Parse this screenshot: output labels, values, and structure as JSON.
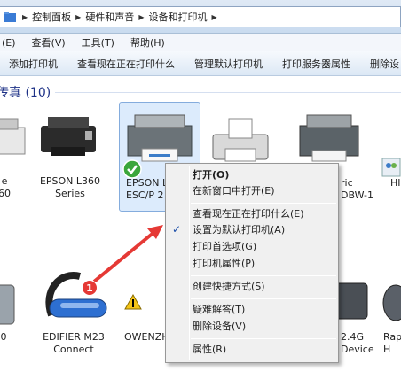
{
  "address": {
    "crumbs": [
      "控制面板",
      "硬件和声音",
      "设备和打印机"
    ]
  },
  "menu": {
    "items": [
      "(E)",
      "查看(V)",
      "工具(T)",
      "帮助(H)"
    ]
  },
  "commands": {
    "items": [
      "添加打印机",
      "查看现在正在打印什么",
      "管理默认打印机",
      "打印服务器属性",
      "删除设"
    ]
  },
  "group": {
    "title": "传真 (10)"
  },
  "devices": [
    {
      "name": [
        "e",
        "60"
      ]
    },
    {
      "name": [
        "EPSON L360",
        "Series"
      ]
    },
    {
      "name": [
        "EPSON L",
        "ESC/P 2 V"
      ]
    },
    {
      "name": [
        "",
        ""
      ]
    },
    {
      "name": [
        "ric",
        "DBW-1"
      ]
    },
    {
      "name": [
        "HI",
        ""
      ]
    },
    {
      "name": [
        "0",
        ""
      ]
    },
    {
      "name": [
        "EDIFIER M23",
        "Connect"
      ]
    },
    {
      "name": [
        "OWENZH",
        ""
      ]
    },
    {
      "name": [
        "2.4G",
        "Device"
      ]
    },
    {
      "name": [
        "Rap",
        "H"
      ]
    }
  ],
  "badge": "1",
  "context_menu": {
    "open": "打开(O)",
    "open_new": "在新窗口中打开(E)",
    "see_printing": "查看现在正在打印什么(E)",
    "set_default": "设置为默认打印机(A)",
    "prefs": "打印首选项(G)",
    "printer_props": "打印机属性(P)",
    "shortcut": "创建快捷方式(S)",
    "troubleshoot": "疑难解答(T)",
    "remove": "删除设备(V)",
    "properties": "属性(R)"
  },
  "colors": {
    "accent": "#1e3287",
    "arrow": "#e53935"
  }
}
